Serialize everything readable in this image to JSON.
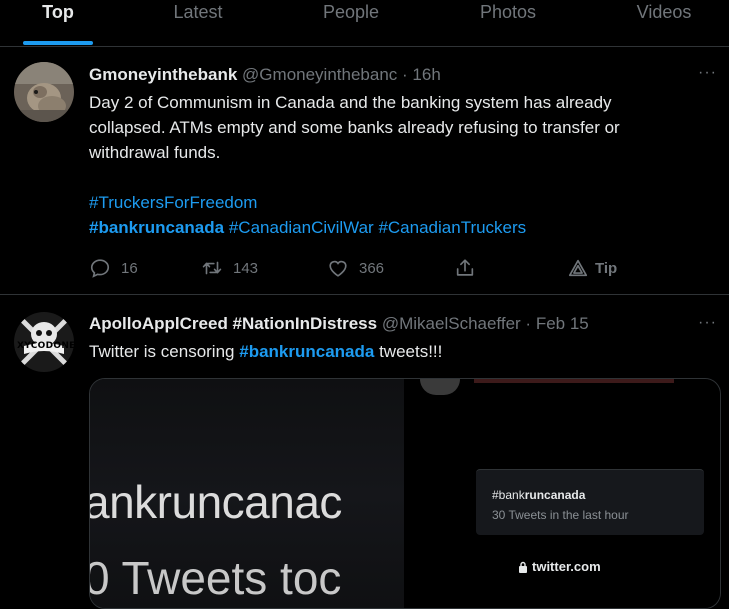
{
  "tabs": [
    {
      "label": "Top",
      "active": true
    },
    {
      "label": "Latest",
      "active": false
    },
    {
      "label": "People",
      "active": false
    },
    {
      "label": "Photos",
      "active": false
    },
    {
      "label": "Videos",
      "active": false
    }
  ],
  "colors": {
    "background": "#000000",
    "accent": "#1d9bf0",
    "muted": "#71767b",
    "text": "#e7e9ea",
    "divider": "#2f3336"
  },
  "tweets": [
    {
      "display_name": "Gmoneyinthebank",
      "handle": "@Gmoneyinthebanc",
      "separator": "·",
      "time": "16h",
      "more": "···",
      "text_line1": "Day 2 of Communism in Canada and the banking system has already",
      "text_line2": "collapsed.  ATMs empty and some banks already refusing to transfer or",
      "text_line3": "withdrawal funds.",
      "hashtag1": "#TruckersForFreedom",
      "hashtag2": "#bankruncanada",
      "hashtag3": "#CanadianCivilWar",
      "hashtag4": "#CanadianTruckers",
      "actions": {
        "reply_count": "16",
        "retweet_count": "143",
        "like_count": "366",
        "tip_label": "Tip"
      },
      "icons": [
        "reply-icon",
        "retweet-icon",
        "like-icon",
        "share-icon",
        "tip-icon"
      ]
    },
    {
      "display_name": "ApolloApplCreed #NationInDistress",
      "handle": "@MikaelSchaeffer",
      "separator": "·",
      "time": "Feb 15",
      "more": "···",
      "text_prefix": "Twitter is censoring ",
      "text_hashtag": "#bankruncanada",
      "text_suffix": " tweets!!!",
      "avatar_text": "XYCODONE",
      "media": {
        "zoom_line1": "ankruncanac",
        "zoom_line2": "0 Tweets toc",
        "trend_tag_prefix": "#bank",
        "trend_tag_bold": "runcanada",
        "trend_count": "30 Tweets in the last hour",
        "url": "twitter.com"
      }
    }
  ]
}
